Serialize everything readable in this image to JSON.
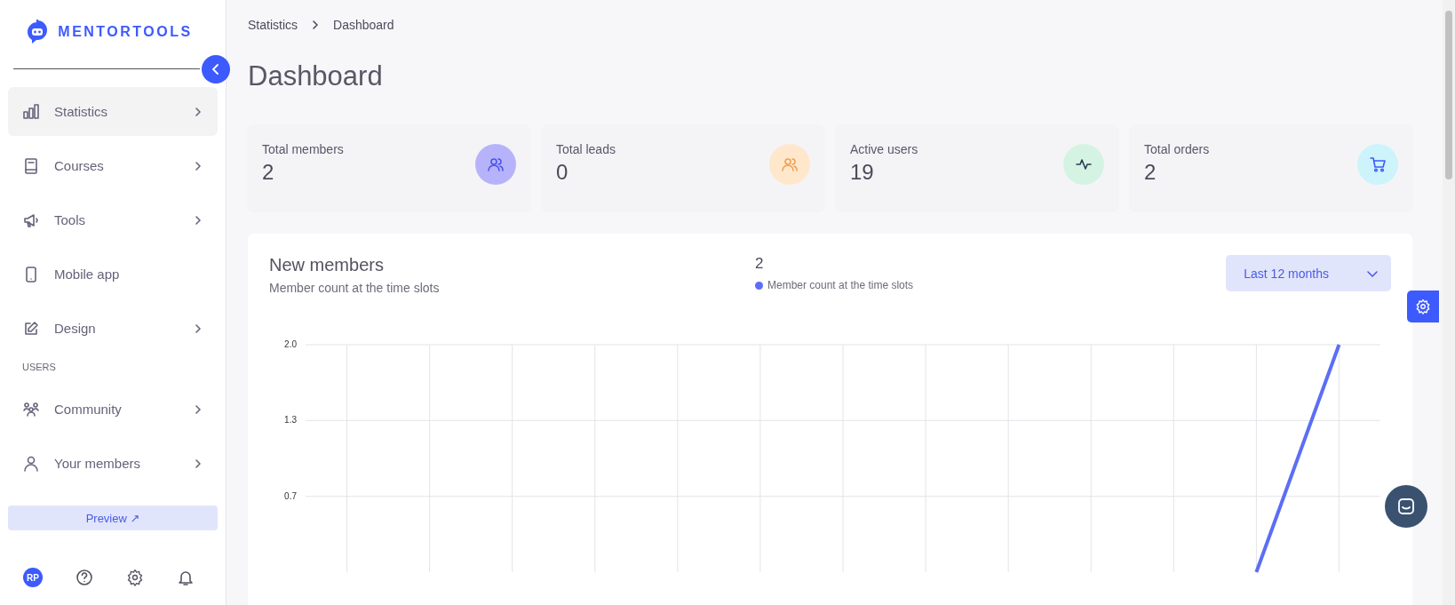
{
  "sidebar": {
    "logo": "MENTORTOOLS",
    "groups": [
      {
        "items": [
          {
            "label": "Statistics",
            "selected": true,
            "expandable": true
          },
          {
            "label": "Courses",
            "selected": false,
            "expandable": true
          },
          {
            "label": "Tools",
            "selected": false,
            "expandable": true
          },
          {
            "label": "Mobile app",
            "selected": false,
            "expandable": false
          },
          {
            "label": "Design",
            "selected": false,
            "expandable": true
          }
        ]
      },
      {
        "heading": "USERS",
        "items": [
          {
            "label": "Community",
            "selected": false,
            "expandable": true
          },
          {
            "label": "Your members",
            "selected": false,
            "expandable": true
          }
        ]
      }
    ],
    "preview_button": "Preview ↗",
    "avatar": "RP"
  },
  "breadcrumb": [
    "Statistics",
    "Dashboard"
  ],
  "page_title": "Dashboard",
  "stat_cards": [
    {
      "label": "Total members",
      "value": "2",
      "color": "#b6b3fb"
    },
    {
      "label": "Total leads",
      "value": "0",
      "color": "#ffe7cc"
    },
    {
      "label": "Active users",
      "value": "19",
      "color": "#d5f3e2"
    },
    {
      "label": "Total orders",
      "value": "2",
      "color": "#cdf3fb"
    }
  ],
  "chart_card": {
    "title": "New members",
    "subtitle": "Member count at the time slots",
    "total": "2",
    "period": "Last 12 months",
    "chart_data": {
      "type": "line",
      "grid": true,
      "series": [
        {
          "name": "Member count at the time slots",
          "color": "#5b6ef5",
          "values": [
            null,
            null,
            null,
            null,
            null,
            null,
            null,
            null,
            null,
            null,
            null,
            0,
            2
          ]
        }
      ],
      "ylim": [
        0,
        2
      ],
      "yticks": [
        {
          "value": 0.6667,
          "label": "0.7"
        },
        {
          "value": 1.3333,
          "label": "1.3"
        },
        {
          "value": 2,
          "label": "2.0"
        }
      ]
    }
  }
}
